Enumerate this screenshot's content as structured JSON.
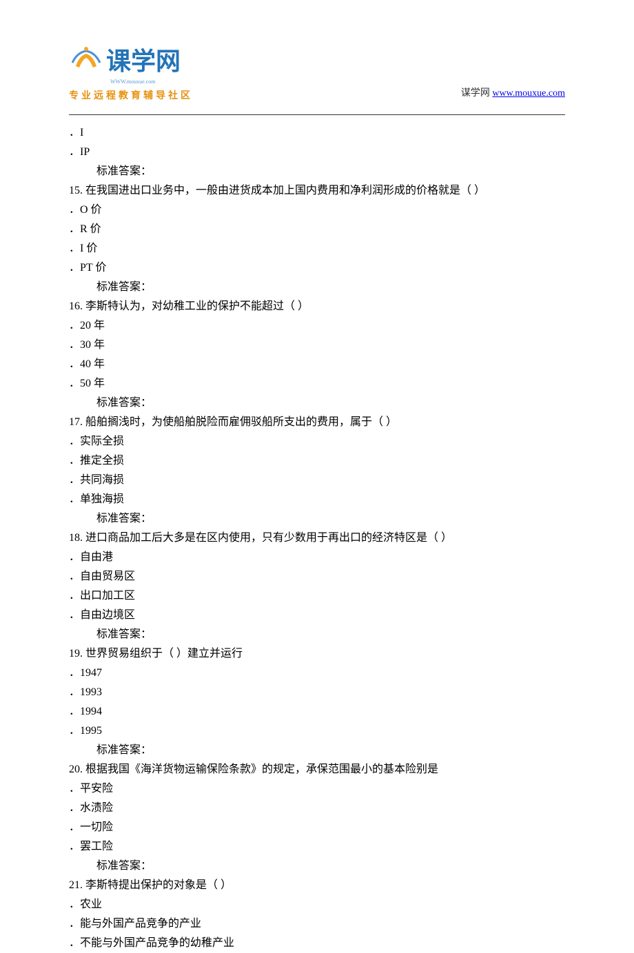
{
  "header": {
    "logo_chars": "课学网",
    "logo_url": "WWW.mouxue.com",
    "logo_subtitle": "专业远程教育辅导社区",
    "site_label": "谋学网 ",
    "site_url": "www.mouxue.com"
  },
  "content": {
    "lines": [
      {
        "type": "option",
        "text": "．I"
      },
      {
        "type": "option",
        "text": "．IP"
      },
      {
        "type": "answer",
        "text": "标准答案："
      },
      {
        "type": "question",
        "text": "15.  在我国进出口业务中，一般由进货成本加上国内费用和净利润形成的价格就是（ ）"
      },
      {
        "type": "option",
        "text": "．O 价"
      },
      {
        "type": "option",
        "text": "．R 价"
      },
      {
        "type": "option",
        "text": "．I 价"
      },
      {
        "type": "option",
        "text": "．PT 价"
      },
      {
        "type": "answer",
        "text": "标准答案："
      },
      {
        "type": "question",
        "text": "16.  李斯特认为，对幼稚工业的保护不能超过（ ）"
      },
      {
        "type": "option",
        "text": "．20 年"
      },
      {
        "type": "option",
        "text": "．30 年"
      },
      {
        "type": "option",
        "text": "．40 年"
      },
      {
        "type": "option",
        "text": "．50 年"
      },
      {
        "type": "answer",
        "text": "标准答案："
      },
      {
        "type": "question",
        "text": "17.  船舶搁浅时，为使船舶脱险而雇佣驳船所支出的费用，属于（ ）"
      },
      {
        "type": "option",
        "text": "．实际全损"
      },
      {
        "type": "option",
        "text": "．推定全损"
      },
      {
        "type": "option",
        "text": "．共同海损"
      },
      {
        "type": "option",
        "text": "．单独海损"
      },
      {
        "type": "answer",
        "text": "标准答案："
      },
      {
        "type": "question",
        "text": "18.  进口商品加工后大多是在区内使用，只有少数用于再出口的经济特区是（ ）"
      },
      {
        "type": "option",
        "text": "．自由港"
      },
      {
        "type": "option",
        "text": "．自由贸易区"
      },
      {
        "type": "option",
        "text": "．出口加工区"
      },
      {
        "type": "option",
        "text": "．自由边境区"
      },
      {
        "type": "answer",
        "text": "标准答案："
      },
      {
        "type": "question",
        "text": "19.  世界贸易组织于（ ）建立并运行"
      },
      {
        "type": "option",
        "text": "．1947"
      },
      {
        "type": "option",
        "text": "．1993"
      },
      {
        "type": "option",
        "text": "．1994"
      },
      {
        "type": "option",
        "text": "．1995"
      },
      {
        "type": "answer",
        "text": "标准答案："
      },
      {
        "type": "question",
        "text": "20.  根据我国《海洋货物运输保险条款》的规定，承保范围最小的基本险别是"
      },
      {
        "type": "option",
        "text": "．平安险"
      },
      {
        "type": "option",
        "text": "．水渍险"
      },
      {
        "type": "option",
        "text": "．一切险"
      },
      {
        "type": "option",
        "text": "．罢工险"
      },
      {
        "type": "answer",
        "text": "标准答案："
      },
      {
        "type": "question",
        "text": "21.  李斯特提出保护的对象是（ ）"
      },
      {
        "type": "option",
        "text": "．农业"
      },
      {
        "type": "option",
        "text": "．能与外国产品竞争的产业"
      },
      {
        "type": "option",
        "text": "．不能与外国产品竞争的幼稚产业"
      }
    ]
  }
}
